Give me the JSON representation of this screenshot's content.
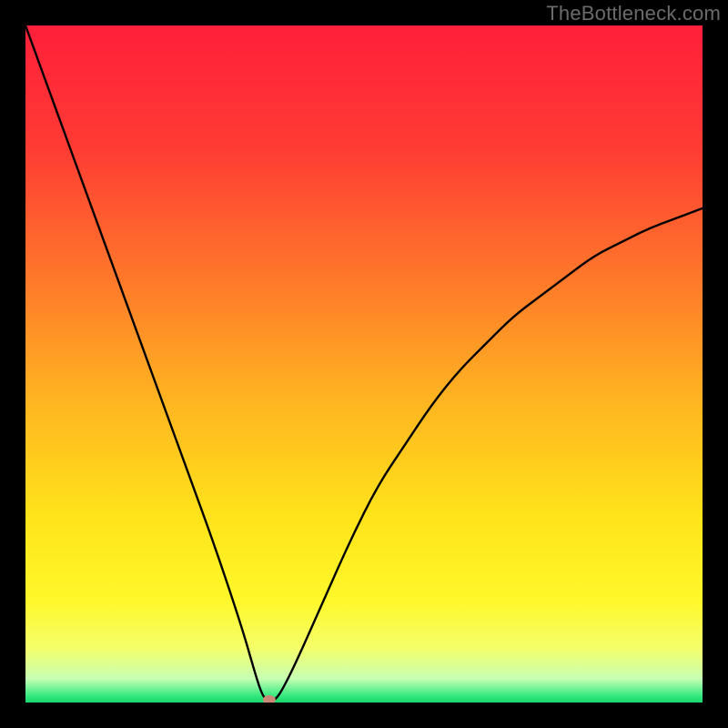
{
  "watermark": "TheBottleneck.com",
  "chart_data": {
    "type": "line",
    "title": "",
    "xlabel": "",
    "ylabel": "",
    "xlim": [
      0,
      100
    ],
    "ylim": [
      0,
      100
    ],
    "grid": false,
    "legend": false,
    "min_marker": {
      "x": 36,
      "y": 0
    },
    "series": [
      {
        "name": "bottleneck-curve",
        "x": [
          0,
          4,
          8,
          12,
          16,
          20,
          24,
          28,
          32,
          34,
          35,
          36,
          37,
          38,
          40,
          44,
          48,
          52,
          56,
          60,
          64,
          68,
          72,
          76,
          80,
          84,
          88,
          92,
          96,
          100
        ],
        "y": [
          100,
          89,
          78,
          67,
          56,
          45,
          34,
          23,
          11,
          4,
          1,
          0,
          0.5,
          2,
          6,
          15,
          24,
          32,
          38,
          44,
          49,
          53,
          57,
          60,
          63,
          66,
          68,
          70,
          71.5,
          73
        ]
      }
    ],
    "background_gradient": {
      "stops": [
        {
          "offset": 0.0,
          "color": "#ff1f3a"
        },
        {
          "offset": 0.18,
          "color": "#ff3b34"
        },
        {
          "offset": 0.38,
          "color": "#ff7a2a"
        },
        {
          "offset": 0.55,
          "color": "#ffb321"
        },
        {
          "offset": 0.72,
          "color": "#ffe21a"
        },
        {
          "offset": 0.85,
          "color": "#fff82a"
        },
        {
          "offset": 0.92,
          "color": "#f4ff6a"
        },
        {
          "offset": 0.965,
          "color": "#c7ffb4"
        },
        {
          "offset": 0.99,
          "color": "#35e97f"
        },
        {
          "offset": 1.0,
          "color": "#17d76a"
        }
      ]
    }
  }
}
